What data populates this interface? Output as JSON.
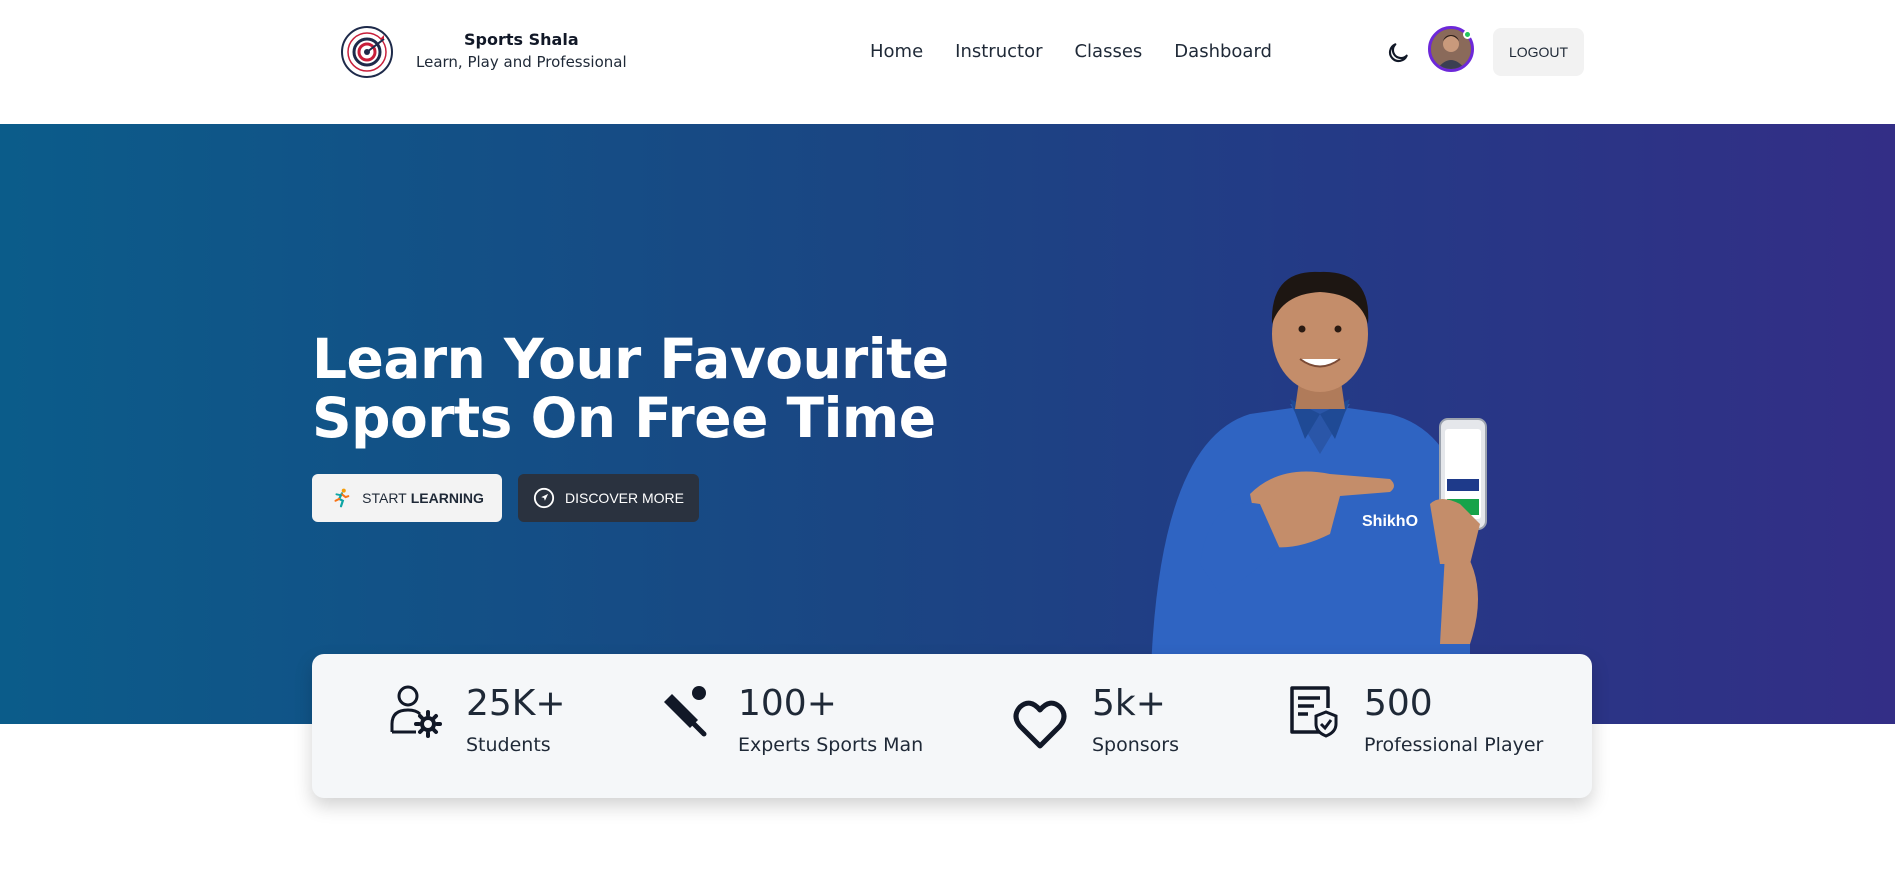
{
  "brand": {
    "name": "Sports Shala",
    "tagline": "Learn, Play and Professional",
    "logo_icon": "target-logo-icon"
  },
  "nav": {
    "links": [
      "Home",
      "Instructor",
      "Classes",
      "Dashboard"
    ],
    "theme_icon": "moon-icon",
    "logout_label": "LOGOUT"
  },
  "hero": {
    "title_line1": "Learn Your Favourite",
    "title_line2": "Sports On Free Time",
    "start_label_light": "START",
    "start_label_bold": "LEARNING",
    "discover_label": "DISCOVER MORE",
    "gradient_start": "#0b5c8a",
    "gradient_end": "#332e86"
  },
  "stats": [
    {
      "icon": "user-gear-icon",
      "value": "25K+",
      "label": "Students"
    },
    {
      "icon": "cricket-bat-icon",
      "value": "100+",
      "label": "Experts Sports Man"
    },
    {
      "icon": "heart-icon",
      "value": "5k+",
      "label": "Sponsors"
    },
    {
      "icon": "certificate-icon",
      "value": "500",
      "label": "Professional Player"
    }
  ],
  "colors": {
    "accent_border": "#6d28d9",
    "dark_button": "#2a323f",
    "online_dot": "#22c55e"
  }
}
